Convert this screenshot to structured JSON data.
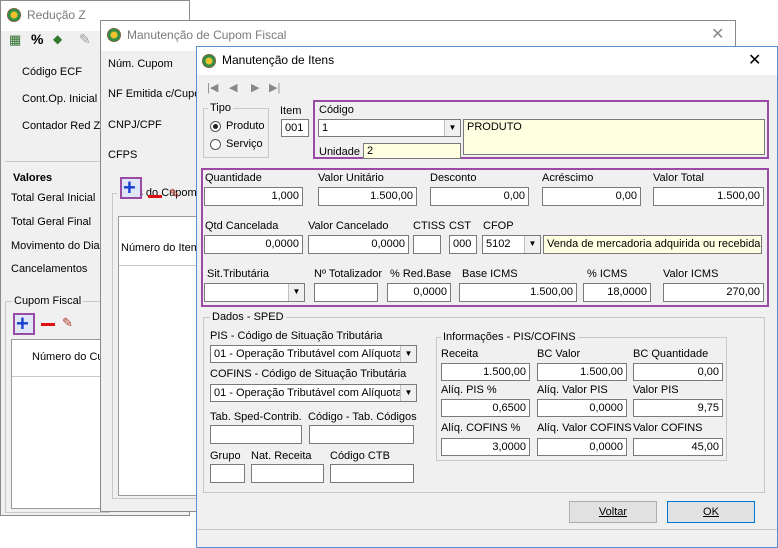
{
  "win1": {
    "title": "Redução Z",
    "toolbar_percent": "%",
    "labels": {
      "codigo_ecf": "Código ECF",
      "cont_op": "Cont.Op. Inicial",
      "contador_red": "Contador Red Z"
    },
    "valores": {
      "heading": "Valores",
      "total_inicial": "Total Geral Inicial",
      "total_final": "Total Geral Final",
      "movimento": "Movimento do Dia",
      "cancelamentos": "Cancelamentos"
    },
    "cupom_fiscal": {
      "title": "Cupom Fiscal",
      "col_numero": "Número do Cup"
    }
  },
  "win2": {
    "title": "Manutenção de Cupom Fiscal",
    "labels": {
      "num_cupom": "Núm. Cupom",
      "nf_emitida": "NF Emitida c/Cupom",
      "cnpj": "CNPJ/CPF",
      "cfps": "CFPS"
    },
    "itens_cupom": {
      "title": "Itens do Cupom",
      "col_numero": "Número do Item"
    }
  },
  "win3": {
    "title": "Manutenção de Itens",
    "tipo": {
      "title": "Tipo",
      "produto": "Produto",
      "servico": "Serviço"
    },
    "item": {
      "label": "Item",
      "value": "001"
    },
    "codigo": {
      "label": "Código",
      "value": "1",
      "descricao": "PRODUTO",
      "unidade_label": "Unidade",
      "unidade_value": "2"
    },
    "valores": {
      "quantidade": {
        "label": "Quantidade",
        "value": "1,000"
      },
      "valor_unitario": {
        "label": "Valor Unitário",
        "value": "1.500,00"
      },
      "desconto": {
        "label": "Desconto",
        "value": "0,00"
      },
      "acrescimo": {
        "label": "Acréscimo",
        "value": "0,00"
      },
      "valor_total": {
        "label": "Valor Total",
        "value": "1.500,00"
      },
      "qtd_cancelada": {
        "label": "Qtd Cancelada",
        "value": "0,0000"
      },
      "valor_cancelado": {
        "label": "Valor Cancelado",
        "value": "0,0000"
      },
      "ctiss": {
        "label": "CTISS",
        "value": ""
      },
      "cst": {
        "label": "CST",
        "value": "000"
      },
      "cfop": {
        "label": "CFOP",
        "value": "5102",
        "descricao": "Venda de mercadoria adquirida ou recebida"
      },
      "sit_tributaria": {
        "label": "Sit.Tributária",
        "value": ""
      },
      "n_totalizador": {
        "label": "Nº Totalizador",
        "value": ""
      },
      "red_base": {
        "label": "% Red.Base",
        "value": "0,0000"
      },
      "base_icms": {
        "label": "Base ICMS",
        "value": "1.500,00"
      },
      "pct_icms": {
        "label": "% ICMS",
        "value": "18,0000"
      },
      "valor_icms": {
        "label": "Valor ICMS",
        "value": "270,00"
      }
    },
    "sped": {
      "title": "Dados - SPED",
      "pis_label": "PIS -  Código de Situação Tributária",
      "pis_value": "01 - Operação Tributável com Alíquota",
      "cofins_label": "COFINS -  Código de Situação Tributária",
      "cofins_value": "01 - Operação Tributável com Alíquota",
      "tab_sped": "Tab. Sped-Contrib.",
      "codigo_tab": "Código - Tab. Códigos",
      "grupo": "Grupo",
      "nat_receita": "Nat. Receita",
      "codigo_ctb": "Código CTB"
    },
    "pis_cofins": {
      "title": "Informações - PIS/COFINS",
      "receita": {
        "label": "Receita",
        "value": "1.500,00"
      },
      "bc_valor": {
        "label": "BC Valor",
        "value": "1.500,00"
      },
      "bc_quantidade": {
        "label": "BC Quantidade",
        "value": "0,00"
      },
      "aliq_pis": {
        "label": "Alíq. PIS %",
        "value": "0,6500"
      },
      "aliq_valor_pis": {
        "label": "Alíq. Valor PIS",
        "value": "0,0000"
      },
      "valor_pis": {
        "label": "Valor PIS",
        "value": "9,75"
      },
      "aliq_cofins": {
        "label": "Alíq. COFINS %",
        "value": "3,0000"
      },
      "aliq_valor_cofins": {
        "label": "Alíq. Valor COFINS",
        "value": "0,0000"
      },
      "valor_cofins": {
        "label": "Valor COFINS",
        "value": "45,00"
      }
    },
    "buttons": {
      "voltar": "Voltar",
      "ok": "OK"
    }
  },
  "colors": {
    "highlight": "#9b4aa6",
    "plus": "#1a3fd0",
    "minus": "#dd1111",
    "yellow_field": "#ffffe1"
  }
}
